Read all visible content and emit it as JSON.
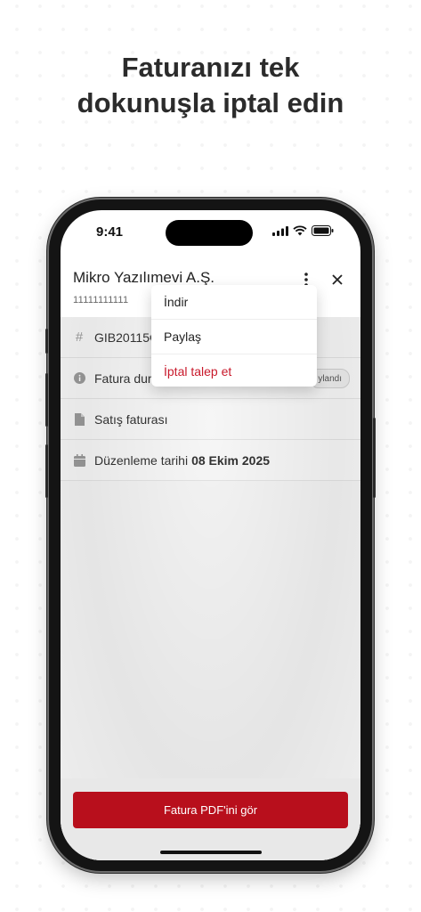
{
  "headline": {
    "line1": "Faturanızı tek",
    "line2": "dokunuşla iptal edin"
  },
  "status_bar": {
    "time": "9:41"
  },
  "header": {
    "title": "Mikro Yazılımevi A.Ş.",
    "subtitle": "11111111111"
  },
  "rows": [
    {
      "icon": "hash-icon",
      "text": "GIB20115€"
    },
    {
      "icon": "info-icon",
      "text": "Fatura dur",
      "badge": "ylandı"
    },
    {
      "icon": "document-icon",
      "text": "Satış faturası"
    },
    {
      "icon": "calendar-icon",
      "text": "Düzenleme tarihi",
      "bold": "08 Ekim 2025"
    }
  ],
  "menu": {
    "items": [
      {
        "label": "İndir"
      },
      {
        "label": "Paylaş"
      },
      {
        "label": "İptal talep et"
      }
    ]
  },
  "footer": {
    "button_label": "Fatura PDF'ini gör"
  },
  "colors": {
    "accent": "#b80f1c",
    "danger_text": "#c8192b"
  }
}
